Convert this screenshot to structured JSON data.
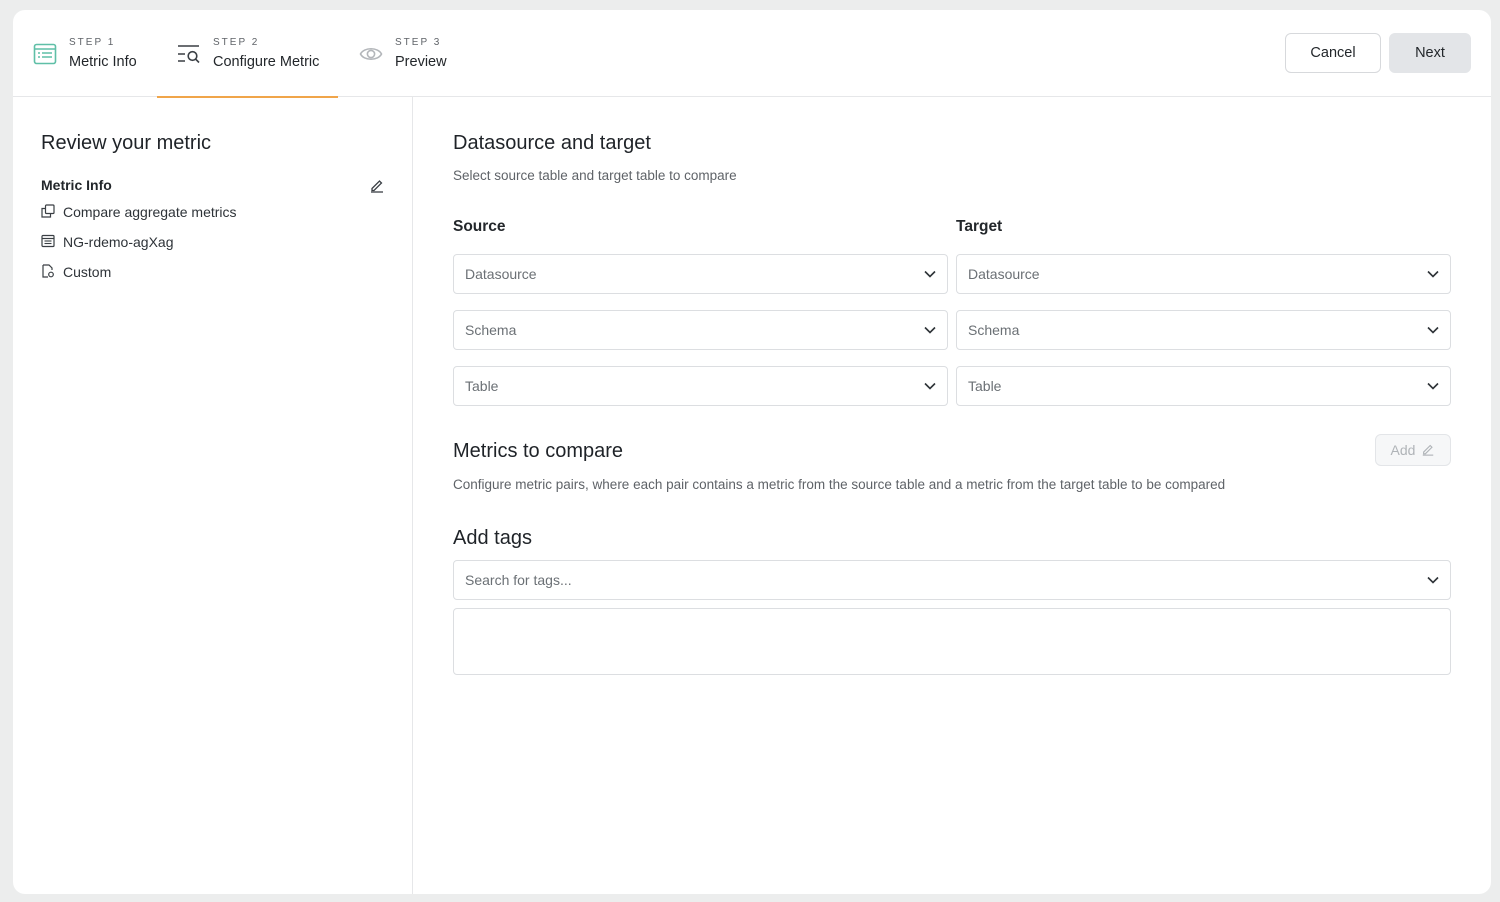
{
  "steps": [
    {
      "label": "STEP 1",
      "name": "Metric Info",
      "icon": "list-icon",
      "color": "#5fbfa7"
    },
    {
      "label": "STEP 2",
      "name": "Configure Metric",
      "icon": "search-list-icon"
    },
    {
      "label": "STEP 3",
      "name": "Preview",
      "icon": "eye-icon"
    }
  ],
  "actions": {
    "cancel": "Cancel",
    "next": "Next"
  },
  "sidebar": {
    "title": "Review your metric",
    "section": "Metric Info",
    "items": [
      {
        "icon": "copy-icon",
        "text": "Compare aggregate metrics"
      },
      {
        "icon": "table-icon",
        "text": "NG-rdemo-agXag"
      },
      {
        "icon": "file-icon",
        "text": "Custom"
      }
    ]
  },
  "datasource": {
    "title": "Datasource and target",
    "subtitle": "Select source table and target table to compare",
    "source": {
      "heading": "Source",
      "datasource": "Datasource",
      "schema": "Schema",
      "table": "Table"
    },
    "target": {
      "heading": "Target",
      "datasource": "Datasource",
      "schema": "Schema",
      "table": "Table"
    }
  },
  "metrics": {
    "title": "Metrics to compare",
    "subtitle": "Configure metric pairs, where each pair contains a metric from the source table and a metric from the target table to be compared",
    "add_label": "Add"
  },
  "tags": {
    "title": "Add tags",
    "placeholder": "Search for tags..."
  },
  "colors": {
    "accent": "#f0a54a",
    "step1_icon": "#5fbfa7"
  }
}
